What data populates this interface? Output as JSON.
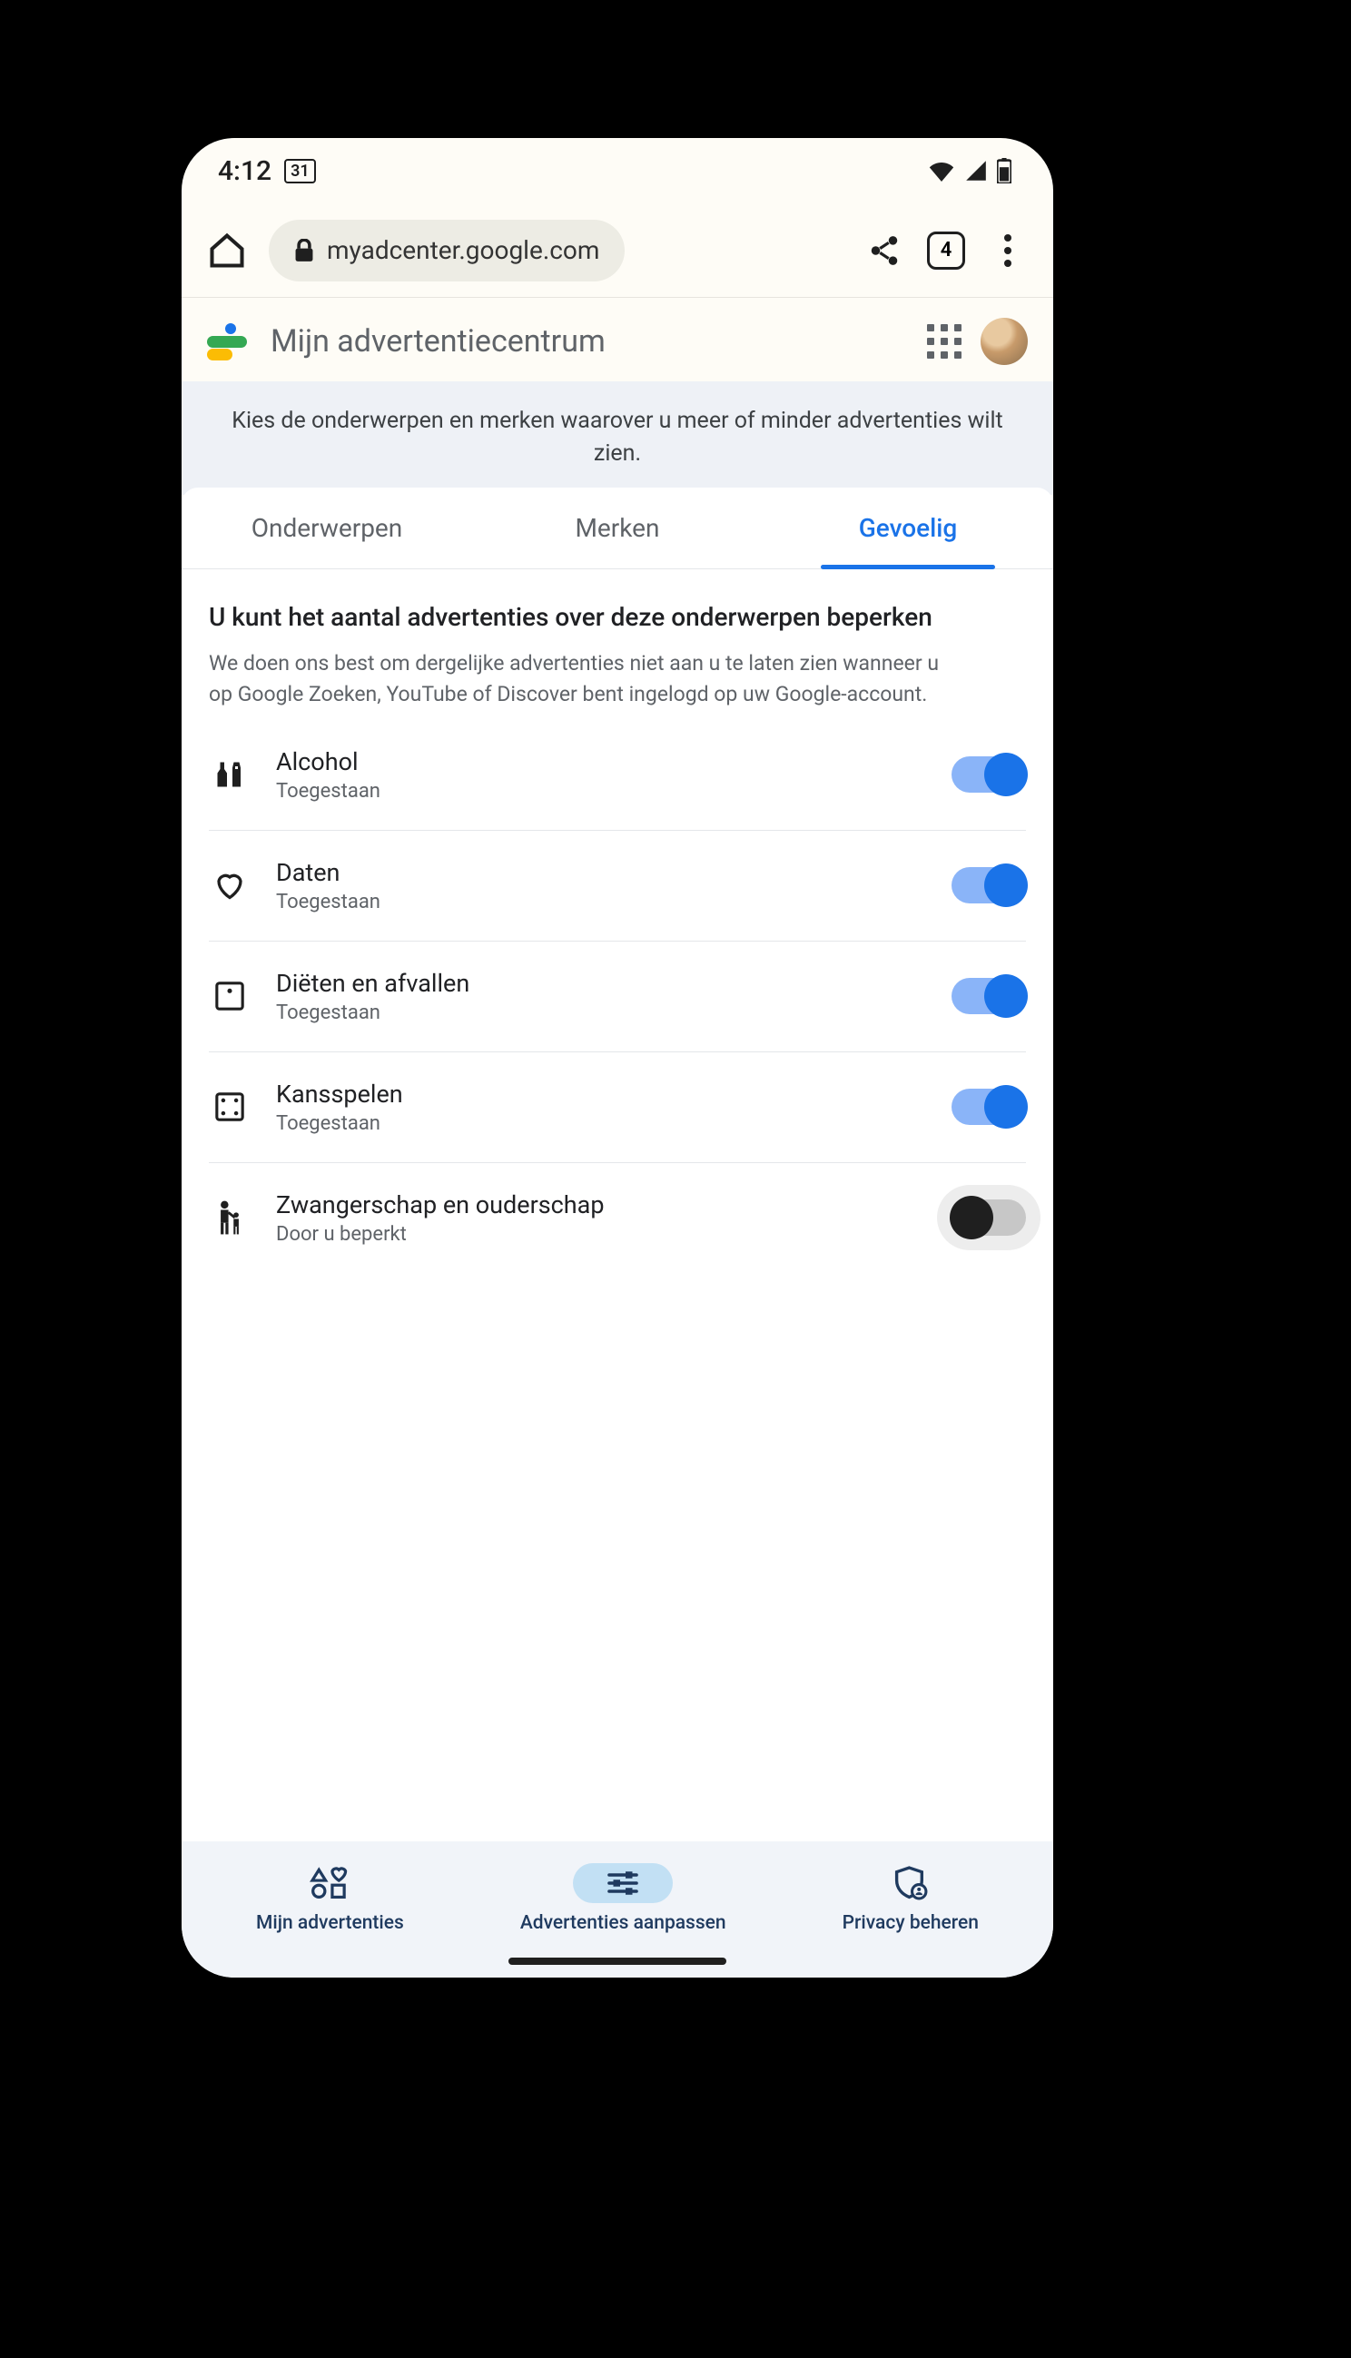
{
  "status": {
    "time": "4:12",
    "date_badge": "31"
  },
  "browser": {
    "url": "myadcenter.google.com",
    "tab_count": "4"
  },
  "header": {
    "title": "Mijn advertentiecentrum"
  },
  "subheading": "Kies de onderwerpen en merken waarover u meer of minder advertenties wilt zien.",
  "tabs": [
    {
      "label": "Onderwerpen",
      "active": false
    },
    {
      "label": "Merken",
      "active": false
    },
    {
      "label": "Gevoelig",
      "active": true
    }
  ],
  "section": {
    "title": "U kunt het aantal advertenties over deze onderwerpen beperken",
    "description": "We doen ons best om dergelijke advertenties niet aan u te laten zien wanneer u op Google Zoeken, YouTube of Discover bent ingelogd op uw Google-account."
  },
  "topics": [
    {
      "title": "Alcohol",
      "subtitle": "Toegestaan",
      "on": true
    },
    {
      "title": "Daten",
      "subtitle": "Toegestaan",
      "on": true
    },
    {
      "title": "Diëten en afvallen",
      "subtitle": "Toegestaan",
      "on": true
    },
    {
      "title": "Kansspelen",
      "subtitle": "Toegestaan",
      "on": true
    },
    {
      "title": "Zwangerschap en ouderschap",
      "subtitle": "Door u beperkt",
      "on": false
    }
  ],
  "bottom_nav": [
    {
      "label": "Mijn advertenties"
    },
    {
      "label": "Advertenties aanpassen"
    },
    {
      "label": "Privacy beheren"
    }
  ]
}
